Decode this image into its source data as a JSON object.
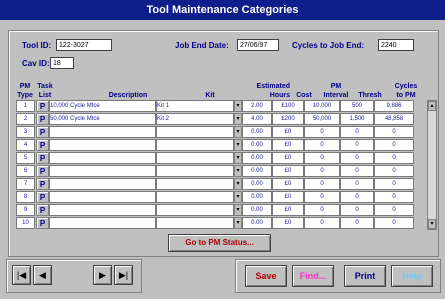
{
  "window": {
    "title": "Tool Maintenance Categories"
  },
  "header": {
    "tool_id_label": "Tool ID:",
    "tool_id_value": "122-3027",
    "job_end_label": "Job End Date:",
    "job_end_value": "27/06/97",
    "cycles_label": "Cycles to Job End:",
    "cycles_value": "2240",
    "cav_id_label": "Cav ID:",
    "cav_id_value": "18"
  },
  "columns": {
    "pm_type": "PM\nType",
    "task_list": "Task\nList",
    "description": "Description",
    "kit": "Kit",
    "hours": "Estimated\nHours",
    "cost": "Cost",
    "interval": "PM\nInterval",
    "thresh": "Thresh",
    "cycles": "Cycles\nto PM"
  },
  "rows": [
    {
      "type": "1",
      "p": "P",
      "desc": "10,000 Cycle Mtce",
      "kit": "Kit 1",
      "hours": "2.00",
      "cost": "£100",
      "interval": "10,000",
      "thresh": "500",
      "cycles": "9,886"
    },
    {
      "type": "2",
      "p": "P",
      "desc": "50,000 Cycle Mtce",
      "kit": "Kit 2",
      "hours": "4.00",
      "cost": "£200",
      "interval": "50,000",
      "thresh": "1,500",
      "cycles": "48,858"
    },
    {
      "type": "3",
      "p": "P",
      "desc": "",
      "kit": "",
      "hours": "0.00",
      "cost": "£0",
      "interval": "0",
      "thresh": "0",
      "cycles": "0"
    },
    {
      "type": "4",
      "p": "P",
      "desc": "",
      "kit": "",
      "hours": "0.00",
      "cost": "£0",
      "interval": "0",
      "thresh": "0",
      "cycles": "0"
    },
    {
      "type": "5",
      "p": "P",
      "desc": "",
      "kit": "",
      "hours": "0.00",
      "cost": "£0",
      "interval": "0",
      "thresh": "0",
      "cycles": "0"
    },
    {
      "type": "6",
      "p": "P",
      "desc": "",
      "kit": "",
      "hours": "0.00",
      "cost": "£0",
      "interval": "0",
      "thresh": "0",
      "cycles": "0"
    },
    {
      "type": "7",
      "p": "P",
      "desc": "",
      "kit": "",
      "hours": "0.00",
      "cost": "£0",
      "interval": "0",
      "thresh": "0",
      "cycles": "0"
    },
    {
      "type": "8",
      "p": "P",
      "desc": "",
      "kit": "",
      "hours": "0.00",
      "cost": "£0",
      "interval": "0",
      "thresh": "0",
      "cycles": "0"
    },
    {
      "type": "9",
      "p": "P",
      "desc": "",
      "kit": "",
      "hours": "0.00",
      "cost": "£0",
      "interval": "0",
      "thresh": "0",
      "cycles": "0"
    },
    {
      "type": "10",
      "p": "P",
      "desc": "",
      "kit": "",
      "hours": "0.00",
      "cost": "£0",
      "interval": "0",
      "thresh": "0",
      "cycles": "0"
    }
  ],
  "buttons": {
    "go_pm_status": "Go to PM Status...",
    "save": "Save",
    "find": "Find...",
    "print": "Print",
    "help": "Help"
  },
  "nav": {
    "first_icon": "first-record-icon",
    "prev_icon": "previous-record-icon",
    "next_icon": "next-record-icon",
    "last_icon": "last-record-icon"
  },
  "colors": {
    "title_bar": "#0f1e8a",
    "label_text": "#00008b",
    "go_button_text": "#b00000",
    "save_text": "#b00000",
    "find_text": "#ff33cc",
    "print_text": "#00008b",
    "help_text": "#66ccff"
  }
}
